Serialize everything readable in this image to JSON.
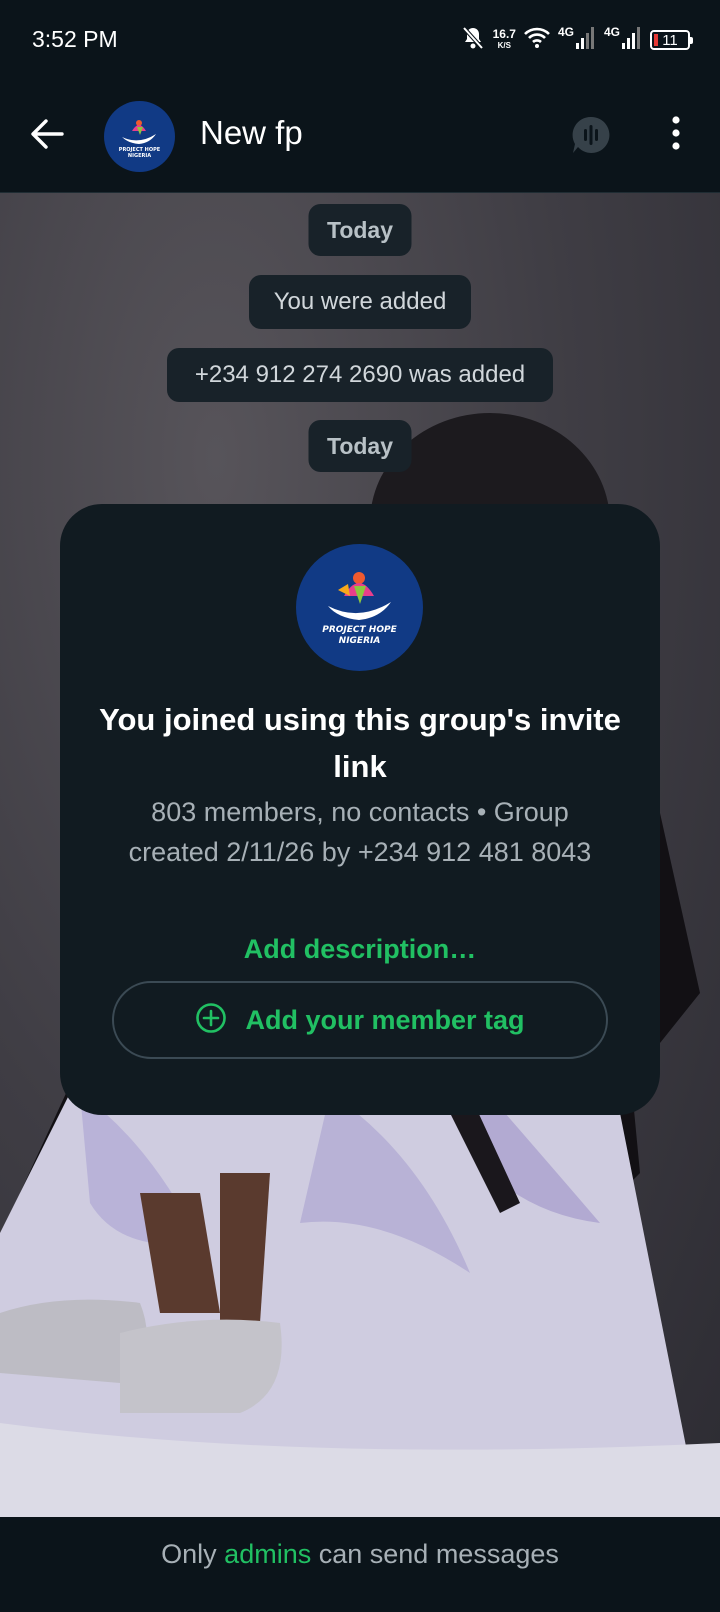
{
  "status_bar": {
    "time": "3:52 PM",
    "speed_value": "16.7",
    "speed_unit": "K/S",
    "network_1": "4G",
    "network_2": "4G",
    "battery": "11"
  },
  "header": {
    "title": "New fp",
    "avatar_text_line1": "PROJECT HOPE",
    "avatar_text_line2": "NIGERIA"
  },
  "chat": {
    "date_1": "Today",
    "event_1": "You were added",
    "event_2": "+234 912 274 2690 was added",
    "date_2": "Today"
  },
  "group_card": {
    "avatar_text_line1": "PROJECT HOPE",
    "avatar_text_line2": "NIGERIA",
    "title": "You joined using this group's invite link",
    "subtitle": "803 members, no contacts • Group created 2/11/26 by +234 912 481 8043",
    "add_description": "Add description…",
    "add_member_tag": "Add your member tag"
  },
  "footer": {
    "prefix": "Only",
    "link": "admins",
    "suffix": "can send messages"
  },
  "colors": {
    "accent": "#21c063",
    "background": "#0b141a",
    "card": "#111b21",
    "avatar": "#113a85"
  }
}
